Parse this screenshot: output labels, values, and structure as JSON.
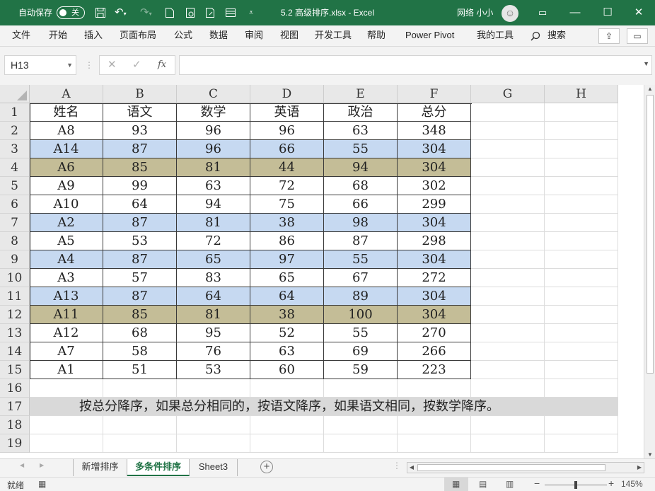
{
  "titlebar": {
    "autosave_label": "自动保存",
    "autosave_state": "关",
    "save_icon": "save-icon",
    "undo_icon": "undo-icon",
    "redo_icon": "redo-icon",
    "title": "5.2 高级排序.xlsx - Excel",
    "user": "网络 小小",
    "window_buttons": {
      "ribbon_display": "▭",
      "minimize": "—",
      "maximize": "☐",
      "close": "✕"
    }
  },
  "menu": {
    "items": [
      "文件",
      "开始",
      "插入",
      "页面布局",
      "公式",
      "数据",
      "审阅",
      "视图",
      "开发工具",
      "帮助",
      "Power Pivot",
      "我的工具"
    ],
    "search_label": "搜索"
  },
  "formula_bar": {
    "name_box": "H13",
    "cancel_symbol": "✕",
    "enter_symbol": "✓",
    "fx_symbol": "fx",
    "formula_value": ""
  },
  "grid": {
    "columns": [
      "A",
      "B",
      "C",
      "D",
      "E",
      "F",
      "G",
      "H"
    ],
    "rows": [
      "1",
      "2",
      "3",
      "4",
      "5",
      "6",
      "7",
      "8",
      "9",
      "10",
      "11",
      "12",
      "13",
      "14",
      "15",
      "16",
      "17",
      "18",
      "19"
    ],
    "selected_cell": "H13",
    "highlight_colors": {
      "blue": "#c6d9f1",
      "tan": "#c4bd97"
    },
    "table": [
      {
        "cells": [
          "姓名",
          "语文",
          "数学",
          "英语",
          "政治",
          "总分"
        ],
        "fill": "none"
      },
      {
        "cells": [
          "A8",
          "93",
          "96",
          "96",
          "63",
          "348"
        ],
        "fill": "none"
      },
      {
        "cells": [
          "A14",
          "87",
          "96",
          "66",
          "55",
          "304"
        ],
        "fill": "blue"
      },
      {
        "cells": [
          "A6",
          "85",
          "81",
          "44",
          "94",
          "304"
        ],
        "fill": "tan"
      },
      {
        "cells": [
          "A9",
          "99",
          "63",
          "72",
          "68",
          "302"
        ],
        "fill": "none"
      },
      {
        "cells": [
          "A10",
          "64",
          "94",
          "75",
          "66",
          "299"
        ],
        "fill": "none"
      },
      {
        "cells": [
          "A2",
          "87",
          "81",
          "38",
          "98",
          "304"
        ],
        "fill": "blue"
      },
      {
        "cells": [
          "A5",
          "53",
          "72",
          "86",
          "87",
          "298"
        ],
        "fill": "none"
      },
      {
        "cells": [
          "A4",
          "87",
          "65",
          "97",
          "55",
          "304"
        ],
        "fill": "blue"
      },
      {
        "cells": [
          "A3",
          "57",
          "83",
          "65",
          "67",
          "272"
        ],
        "fill": "none"
      },
      {
        "cells": [
          "A13",
          "87",
          "64",
          "64",
          "89",
          "304"
        ],
        "fill": "blue"
      },
      {
        "cells": [
          "A11",
          "85",
          "81",
          "38",
          "100",
          "304"
        ],
        "fill": "tan"
      },
      {
        "cells": [
          "A12",
          "68",
          "95",
          "52",
          "55",
          "270"
        ],
        "fill": "none"
      },
      {
        "cells": [
          "A7",
          "58",
          "76",
          "63",
          "69",
          "266"
        ],
        "fill": "none"
      },
      {
        "cells": [
          "A1",
          "51",
          "53",
          "60",
          "59",
          "223"
        ],
        "fill": "none"
      }
    ],
    "note": "按总分降序，如果总分相同的，按语文降序，如果语文相同，按数学降序。",
    "note_fill": "#d9d9d9"
  },
  "sheets": {
    "tabs": [
      "新增排序",
      "多条件排序",
      "Sheet3"
    ],
    "active": "多条件排序",
    "add_symbol": "+"
  },
  "status": {
    "ready": "就绪",
    "zoom": "145%",
    "zoom_minus": "−",
    "zoom_plus": "+"
  },
  "colors": {
    "excel_green": "#217346",
    "header_gray": "#e8e8e8",
    "ribbon_bg": "#f3f3f3"
  }
}
